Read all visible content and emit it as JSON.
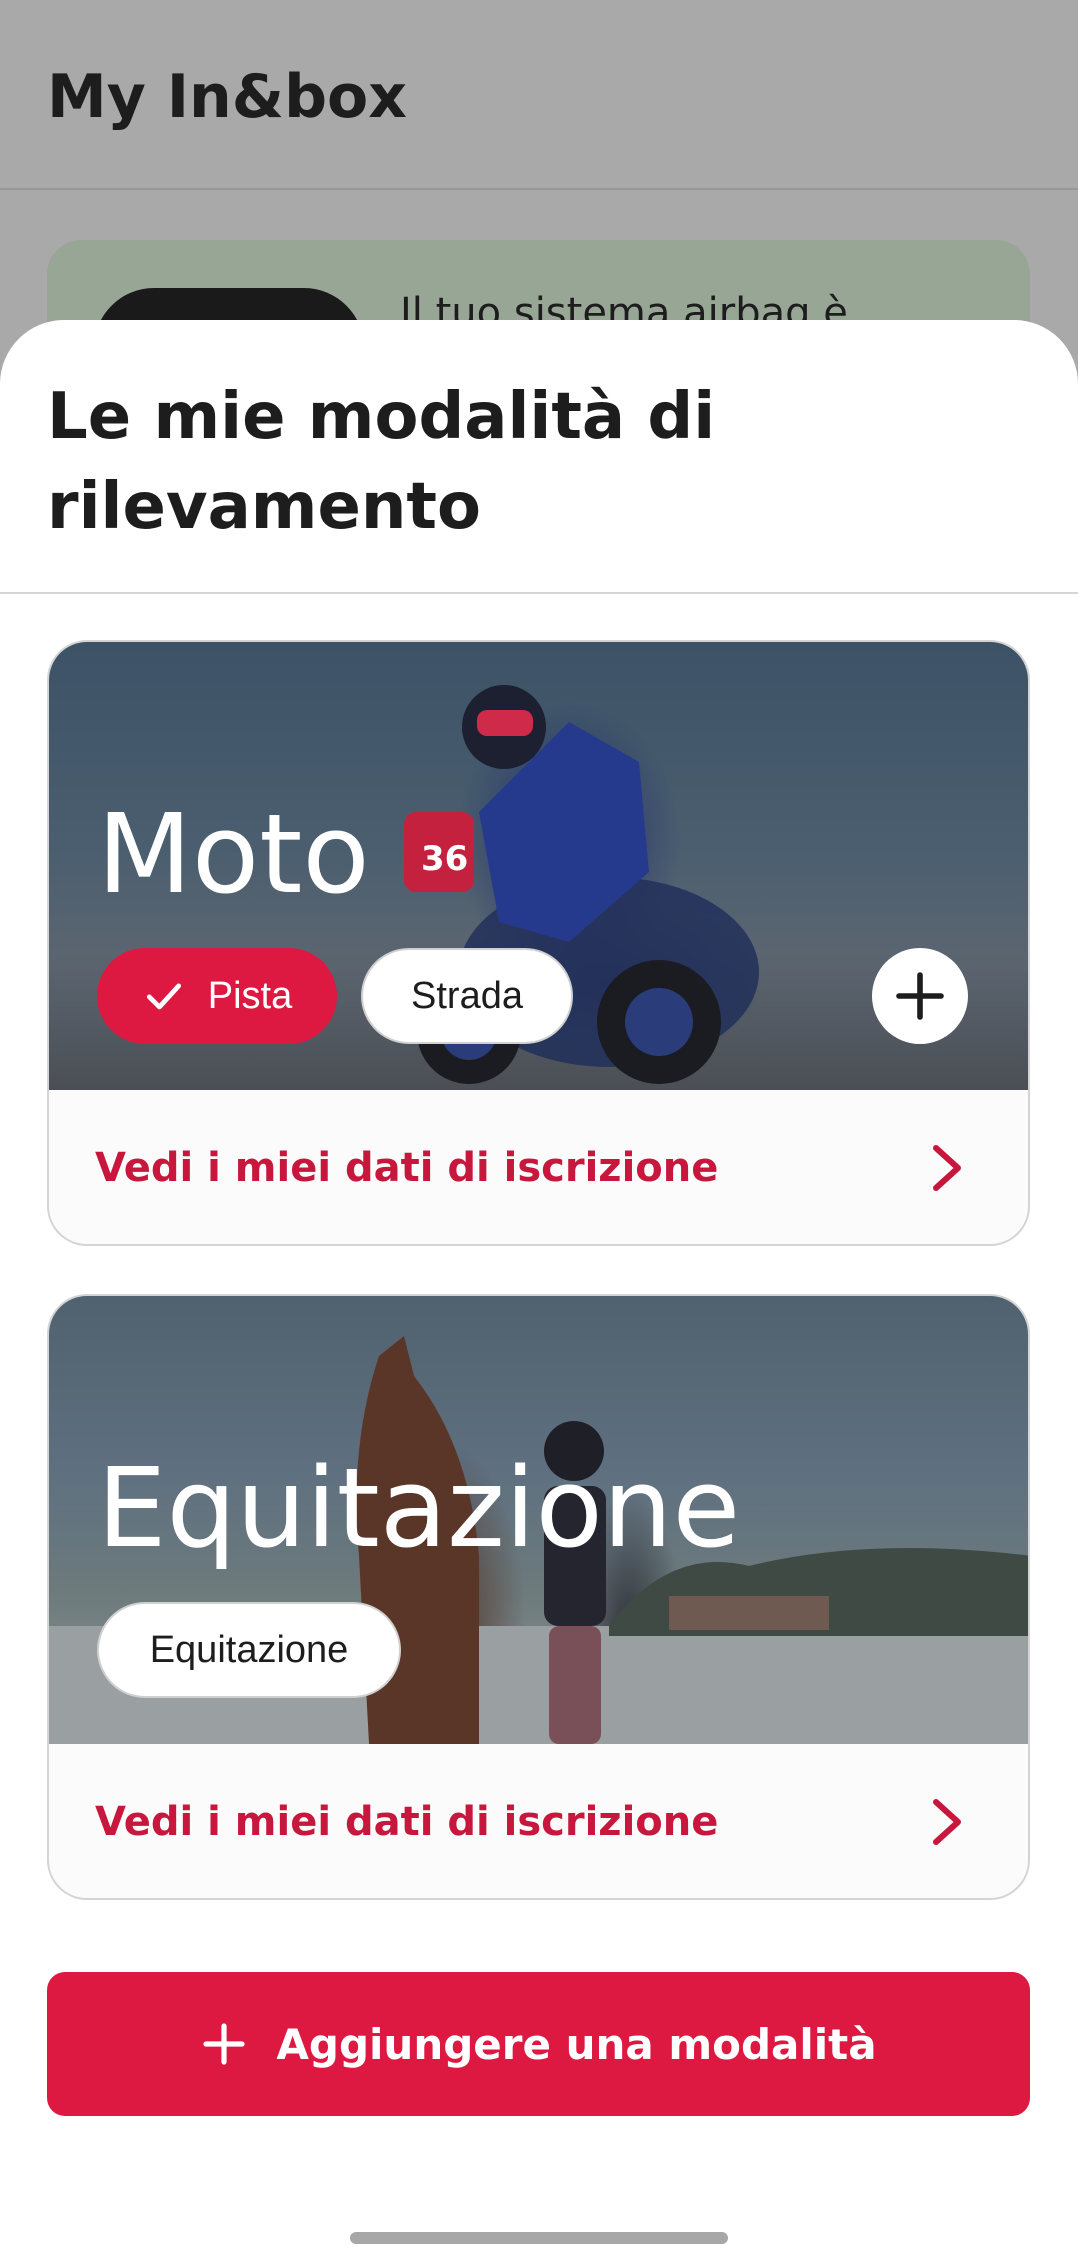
{
  "background": {
    "title": "My In&box",
    "banner_text": "Il tuo sistema airbag è"
  },
  "sheet": {
    "title": "Le mie modalità di rilevamento"
  },
  "cards": [
    {
      "title": "Moto",
      "chips": [
        {
          "label": "Pista",
          "selected": true
        },
        {
          "label": "Strada",
          "selected": false
        }
      ],
      "has_add_button": true,
      "link_label": "Vedi i miei dati di iscrizione"
    },
    {
      "title": "Equitazione",
      "chips": [
        {
          "label": "Equitazione",
          "selected": false
        }
      ],
      "has_add_button": false,
      "link_label": "Vedi i miei dati di iscrizione"
    }
  ],
  "primary_button": {
    "label": "Aggiungere una modalità",
    "icon": "plus-icon"
  },
  "colors": {
    "accent": "#dd1942",
    "link": "#c8173d",
    "text": "#1d1d1d"
  }
}
